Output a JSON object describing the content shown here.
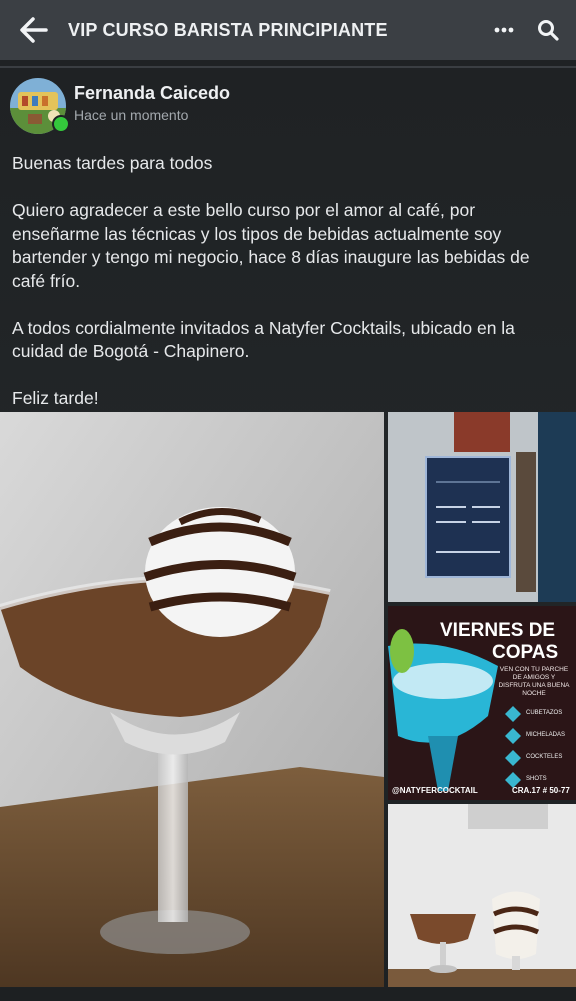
{
  "header": {
    "title": "VIP CURSO BARISTA PRINCIPIANTE",
    "back_icon": "arrow-left-icon",
    "more_icon": "more-dots-icon",
    "search_icon": "search-icon"
  },
  "post": {
    "author": "Fernanda Caicedo",
    "timestamp": "Hace un momento",
    "online": true,
    "paragraphs": [
      "Buenas tardes para todos",
      "Quiero agradecer a este bello curso por el amor al café, por enseñarme las técnicas y los tipos de bebidas actualmente soy bartender y tengo mi negocio, hace 8 días inaugure las bebidas de café frío.",
      "A todos cordialmente invitados a Natyfer Cocktails, ubicado en la cuidad de Bogotá - Chapinero.",
      "Feliz tarde!"
    ]
  },
  "photos": {
    "flyer": {
      "title_line1": "VIERNES DE",
      "title_line2": "COPAS",
      "tagline": "VEN CON TU PARCHE DE AMIGOS Y DISFRUTA UNA BUENA NOCHE",
      "items": [
        "CUBETAZOS",
        "MICHELADAS",
        "COCKTELES",
        "SHOTS"
      ],
      "handle": "@NATYFERCOCKTAIL",
      "address": "CRA.17 # 50-77"
    }
  },
  "colors": {
    "topbar": "#3b3f44",
    "background": "#1f2224",
    "online": "#34c83c"
  }
}
